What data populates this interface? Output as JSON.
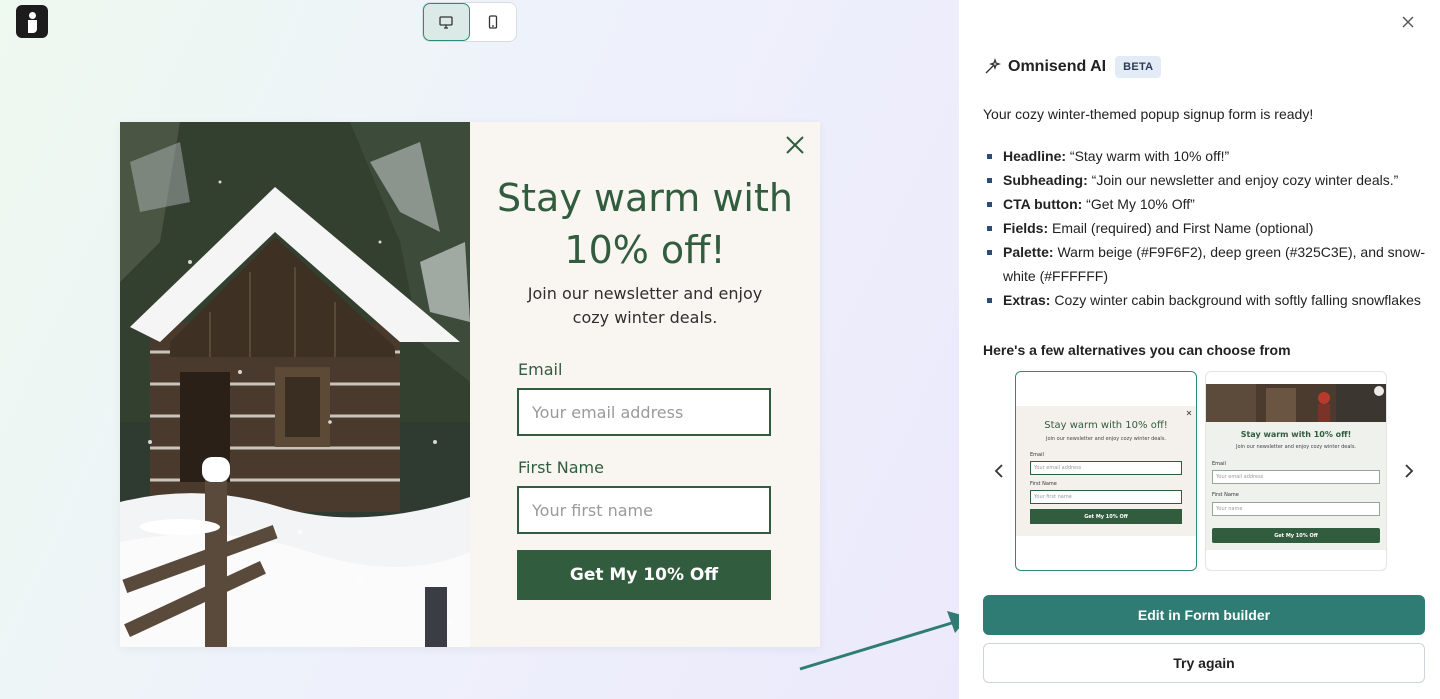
{
  "toolbar": {
    "logo_icon": "omnisend-logo-icon",
    "desktop_icon": "monitor-icon",
    "mobile_icon": "smartphone-icon",
    "active_view": "desktop"
  },
  "preview": {
    "headline": "Stay warm with 10% off!",
    "subheading": "Join our newsletter and enjoy cozy winter deals.",
    "email_label": "Email",
    "email_placeholder": "Your email address",
    "name_label": "First Name",
    "name_placeholder": "Your first name",
    "cta_label": "Get My 10% Off",
    "colors": {
      "background": "#F9F6F2",
      "primary": "#325C3E",
      "white": "#FFFFFF"
    }
  },
  "panel": {
    "title": "Omnisend AI",
    "badge": "BETA",
    "intro": "Your cozy winter-themed popup signup form is ready!",
    "details": [
      {
        "label": "Headline:",
        "text": " “Stay warm with 10% off!”"
      },
      {
        "label": "Subheading:",
        "text": " “Join our newsletter and enjoy cozy winter deals.”"
      },
      {
        "label": "CTA button:",
        "text": " “Get My 10% Off”"
      },
      {
        "label": "Fields:",
        "text": " Email (required) and First Name (optional)"
      },
      {
        "label": "Palette:",
        "text": " Warm beige (#F9F6F2), deep green (#325C3E), and snow-white (#FFFFFF)"
      },
      {
        "label": "Extras:",
        "text": " Cozy winter cabin background with softly falling snowflakes"
      }
    ],
    "alternatives_heading": "Here's a few alternatives you can choose from",
    "alternatives": [
      {
        "headline": "Stay warm with 10% off!",
        "subheading": "Join our newsletter and enjoy cozy winter deals.",
        "email_label": "Email",
        "email_placeholder": "Your email address",
        "name_label": "First Name",
        "name_placeholder": "Your first name",
        "cta": "Get My 10% Off"
      },
      {
        "headline": "Stay warm with 10% off!",
        "subheading": "Join our newsletter and enjoy cozy winter deals.",
        "email_label": "Email",
        "email_placeholder": "Your email address",
        "name_label": "First Name",
        "name_placeholder": "Your name",
        "cta": "Get My 10% Off"
      }
    ],
    "edit_button": "Edit in Form builder",
    "retry_button": "Try again",
    "accent_color": "#2F7C74"
  }
}
